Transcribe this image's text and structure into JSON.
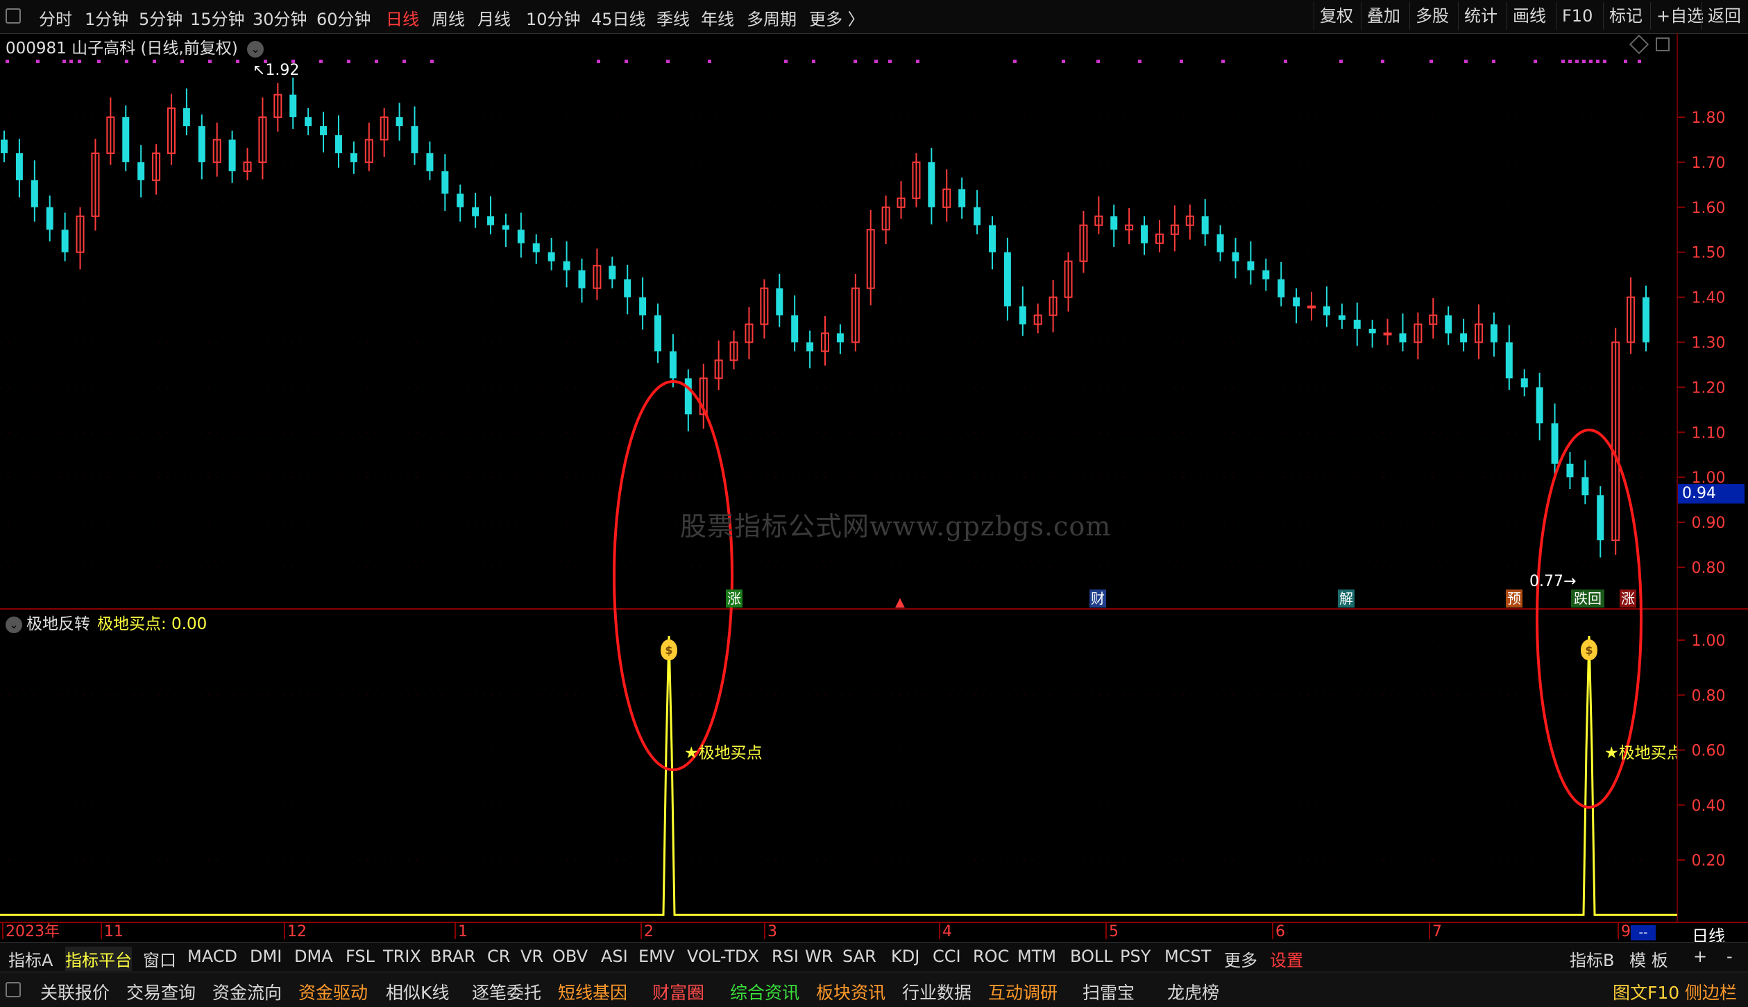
{
  "toolbar": {
    "periods": [
      "分时",
      "1分钟",
      "5分钟",
      "15分钟",
      "30分钟",
      "60分钟",
      "日线",
      "周线",
      "月线",
      "10分钟",
      "45日线",
      "季线",
      "年线",
      "多周期",
      "更多 〉"
    ],
    "active_period": "日线",
    "right_buttons": [
      "复权",
      "叠加",
      "多股",
      "统计",
      "画线",
      "F10",
      "标记",
      "+自选",
      "返回"
    ]
  },
  "stock": {
    "code": "000981",
    "name": "山子高科",
    "mode": "(日线,前复权)"
  },
  "main_chart": {
    "price_axis": [
      "1.80",
      "1.70",
      "1.60",
      "1.50",
      "1.40",
      "1.30",
      "1.20",
      "1.10",
      "1.00",
      "0.90",
      "0.80"
    ],
    "current_price": "0.94",
    "high_label": "1.92",
    "low_label": "0.77",
    "event_tags": [
      "涨",
      "财",
      "解",
      "预",
      "跌回",
      "涨"
    ]
  },
  "watermark": "股票指标公式网www.gpzbgs.com",
  "sub_chart": {
    "indicator_name": "极地反转",
    "value_label": "极地买点: 0.00",
    "axis": [
      "1.00",
      "0.80",
      "0.60",
      "0.40",
      "0.20"
    ],
    "signal_label_1": "★极地买点",
    "signal_label_2": "★极地买点"
  },
  "date_axis": {
    "labels": [
      "2023年",
      "11",
      "12",
      "1",
      "2",
      "3",
      "4",
      "5",
      "6",
      "7",
      "9"
    ],
    "period": "日线"
  },
  "indicator_tabs": [
    "指标A",
    "指标平台",
    "窗口",
    "MACD",
    "DMI",
    "DMA",
    "FSL",
    "TRIX",
    "BRAR",
    "CR",
    "VR",
    "OBV",
    "ASI",
    "EMV",
    "VOL-TDX",
    "RSI",
    "WR",
    "SAR",
    "KDJ",
    "CCI",
    "ROC",
    "MTM",
    "BOLL",
    "PSY",
    "MCST",
    "更多",
    "设置"
  ],
  "indicator_right": [
    "指标B",
    "模 板",
    "+",
    "-"
  ],
  "bottom_tabs": [
    "关联报价",
    "交易查询",
    "资金流向",
    "资金驱动",
    "相似K线",
    "逐笔委托",
    "短线基因",
    "财富圈",
    "综合资讯",
    "板块资讯",
    "行业数据",
    "互动调研",
    "扫雷宝",
    "龙虎榜"
  ],
  "bottom_right": [
    "图文F10",
    "侧边栏"
  ],
  "colors": {
    "up": "#ff3b3b",
    "down": "#22dddd",
    "signal": "#ffff30",
    "ellipse": "#ff1a1a"
  }
}
